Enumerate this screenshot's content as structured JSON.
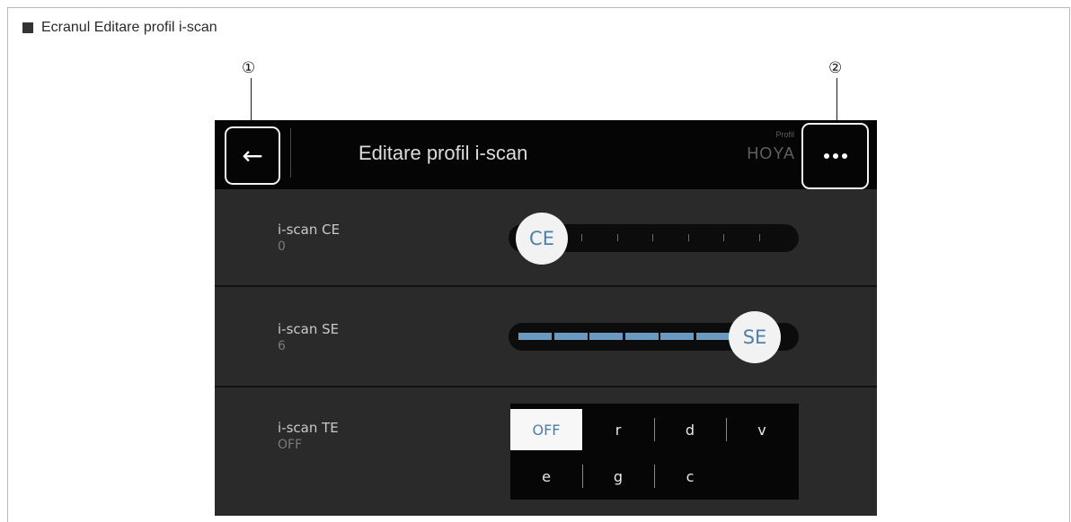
{
  "caption": {
    "text": "Ecranul Editare profil i-scan"
  },
  "callouts": [
    {
      "label": "①"
    },
    {
      "label": "②"
    }
  ],
  "header": {
    "back_icon": "arrow-left-icon",
    "back_glyph": "←",
    "title": "Editare profil i-scan",
    "profile_caption": "Profil",
    "profile_name": "HOYA",
    "more_icon": "more-horizontal-icon"
  },
  "rows": [
    {
      "label": "i-scan CE",
      "value": "0",
      "knob_label": "CE",
      "level": 0,
      "max": 6
    },
    {
      "label": "i-scan SE",
      "value": "6",
      "knob_label": "SE",
      "level": 6,
      "max": 6
    },
    {
      "label": "i-scan TE",
      "value": "OFF"
    }
  ],
  "te_options": [
    {
      "label": "OFF",
      "selected": true
    },
    {
      "label": "r",
      "selected": false
    },
    {
      "label": "d",
      "selected": false
    },
    {
      "label": "v",
      "selected": false
    },
    {
      "label": "e",
      "selected": false
    },
    {
      "label": "g",
      "selected": false
    },
    {
      "label": "c",
      "selected": false
    }
  ],
  "colors": {
    "accent": "#4e7fa8",
    "fill": "#6b9ac1",
    "header_bg": "#050505",
    "panel_bg": "#2a2a2a"
  }
}
